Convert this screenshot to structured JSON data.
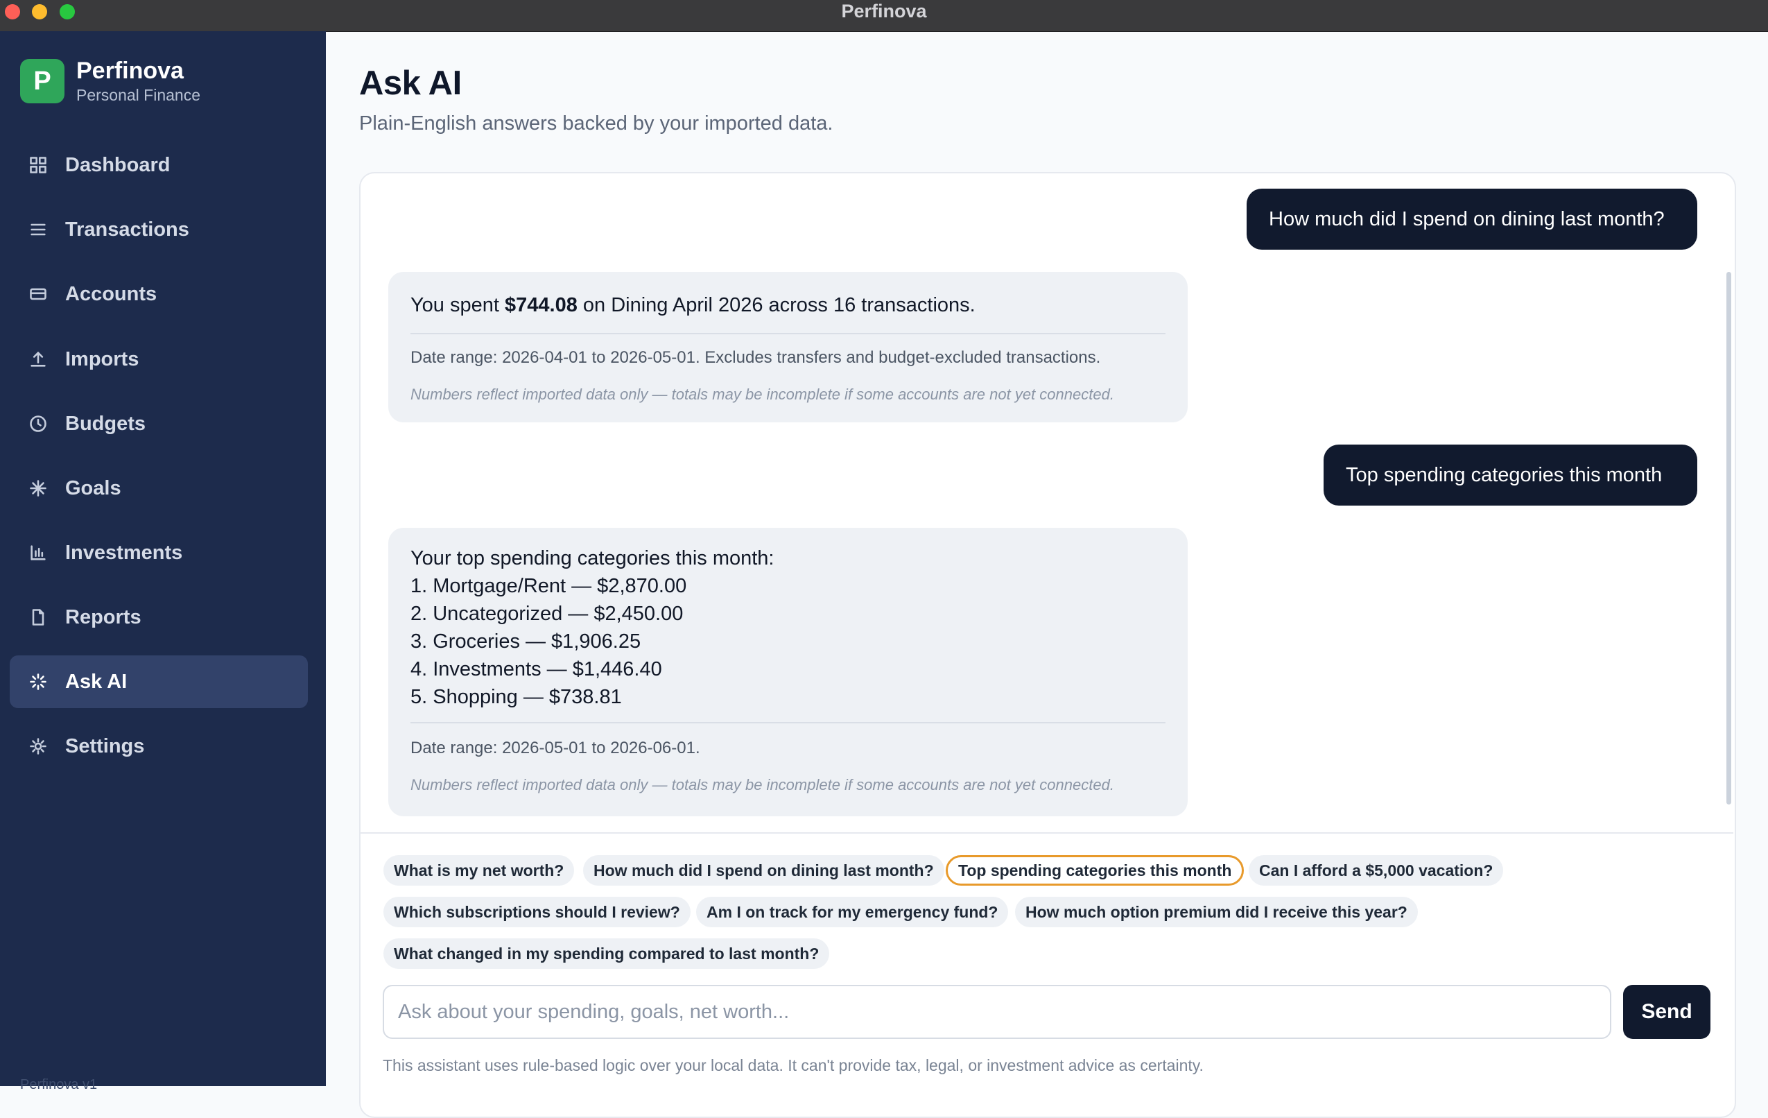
{
  "window": {
    "title": "Perfinova"
  },
  "sidebar": {
    "brand": {
      "initial": "P",
      "name": "Perfinova",
      "subtitle": "Personal Finance"
    },
    "items": [
      {
        "label": "Dashboard",
        "icon": "grid-icon"
      },
      {
        "label": "Transactions",
        "icon": "list-icon"
      },
      {
        "label": "Accounts",
        "icon": "card-icon"
      },
      {
        "label": "Imports",
        "icon": "upload-icon"
      },
      {
        "label": "Budgets",
        "icon": "clock-icon"
      },
      {
        "label": "Goals",
        "icon": "sparkle-icon"
      },
      {
        "label": "Investments",
        "icon": "bar-chart-icon"
      },
      {
        "label": "Reports",
        "icon": "document-icon"
      },
      {
        "label": "Ask AI",
        "icon": "loader-icon",
        "active": true
      },
      {
        "label": "Settings",
        "icon": "gear-icon"
      }
    ],
    "footer": "Perfinova v1"
  },
  "main": {
    "title": "Ask AI",
    "subtitle": "Plain-English answers backed by your imported data."
  },
  "chat": {
    "messages": [
      {
        "role": "user",
        "text": "How much did I spend on dining last month?"
      },
      {
        "role": "assistant",
        "text_prefix": "You spent ",
        "amount": "$744.08",
        "text_suffix": " on Dining April 2026 across 16 transactions.",
        "date_range": "Date range: 2026-04-01 to 2026-05-01. Excludes transfers and budget-excluded transactions.",
        "note": "Numbers reflect imported data only — totals may be incomplete if some accounts are not yet connected."
      },
      {
        "role": "user",
        "text": "Top spending categories this month"
      },
      {
        "role": "assistant",
        "intro": "Your top spending categories this month:",
        "lines": [
          "1. Mortgage/Rent — $2,870.00",
          "2. Uncategorized — $2,450.00",
          "3. Groceries — $1,906.25",
          "4. Investments — $1,446.40",
          "5. Shopping — $738.81"
        ],
        "date_range": "Date range: 2026-05-01 to 2026-06-01.",
        "note": "Numbers reflect imported data only — totals may be incomplete if some accounts are not yet connected."
      }
    ]
  },
  "suggestions": [
    "What is my net worth?",
    "How much did I spend on dining last month?",
    "Top spending categories this month",
    "Can I afford a $5,000 vacation?",
    "Which subscriptions should I review?",
    "Am I on track for my emergency fund?",
    "How much option premium did I receive this year?",
    "What changed in my spending compared to last month?"
  ],
  "selected_suggestion": "Top spending categories this month",
  "composer": {
    "value": "",
    "placeholder": "Ask about your spending, goals, net worth...",
    "send_label": "Send",
    "disclaimer": "This assistant uses rule-based logic over your local data. It can't provide tax, legal, or investment advice as certainty."
  },
  "colors": {
    "sidebar_bg": "#1d2b4c",
    "sidebar_active": "#32426a",
    "brand_green": "#2fa65a",
    "user_bubble": "#111a2e",
    "assistant_bubble": "#eef1f5",
    "selected_chip_border": "#e89a2b"
  }
}
